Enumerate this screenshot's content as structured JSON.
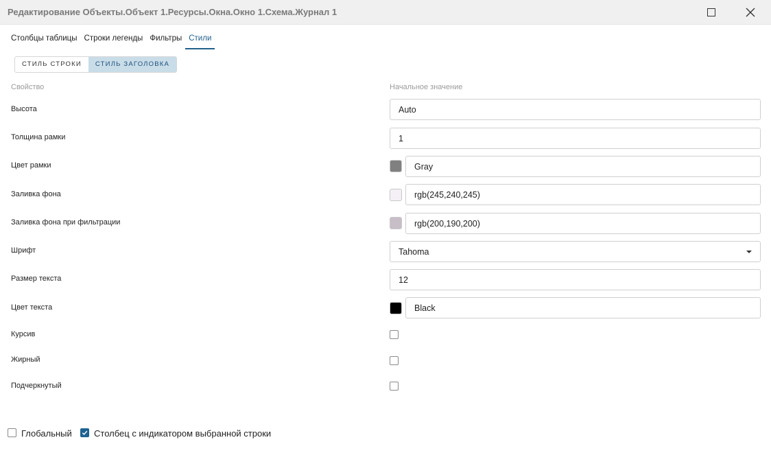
{
  "window": {
    "title": "Редактирование Объекты.Объект 1.Ресурсы.Окна.Окно 1.Схема.Журнал 1",
    "maximize_icon": "maximize-icon",
    "close_icon": "close-icon"
  },
  "tabs": [
    {
      "label": "Столбцы таблицы",
      "active": false
    },
    {
      "label": "Строки легенды",
      "active": false
    },
    {
      "label": "Фильтры",
      "active": false
    },
    {
      "label": "Стили",
      "active": true
    }
  ],
  "style_switch": [
    {
      "label": "СТИЛЬ СТРОКИ",
      "active": false
    },
    {
      "label": "СТИЛЬ ЗАГОЛОВКА",
      "active": true
    }
  ],
  "columns": {
    "property": "Свойство",
    "initial_value": "Начальное значение"
  },
  "rows": {
    "height": {
      "label": "Высота",
      "value": "Auto"
    },
    "border_width": {
      "label": "Толщина рамки",
      "value": "1"
    },
    "border_color": {
      "label": "Цвет рамки",
      "value": "Gray",
      "swatch": "#808080"
    },
    "background": {
      "label": "Заливка фона",
      "value": "rgb(245,240,245)",
      "swatch": "#f5f0f5"
    },
    "filter_background": {
      "label": "Заливка фона при фильтрации",
      "value": "rgb(200,190,200)",
      "swatch": "#c8bec8"
    },
    "font": {
      "label": "Шрифт",
      "value": "Tahoma"
    },
    "font_size": {
      "label": "Размер текста",
      "value": "12"
    },
    "text_color": {
      "label": "Цвет текста",
      "value": "Black",
      "swatch": "#000000"
    },
    "italic": {
      "label": "Курсив",
      "checked": false
    },
    "bold": {
      "label": "Жирный",
      "checked": false
    },
    "underline": {
      "label": "Подчеркнутый",
      "checked": false
    }
  },
  "footer": {
    "global": {
      "label": "Глобальный",
      "checked": false
    },
    "indicator_column": {
      "label": "Столбец с индикатором выбранной строки",
      "checked": true
    }
  },
  "colors": {
    "accent": "#1f5f8b",
    "active_segment_bg": "#c9dde9"
  }
}
